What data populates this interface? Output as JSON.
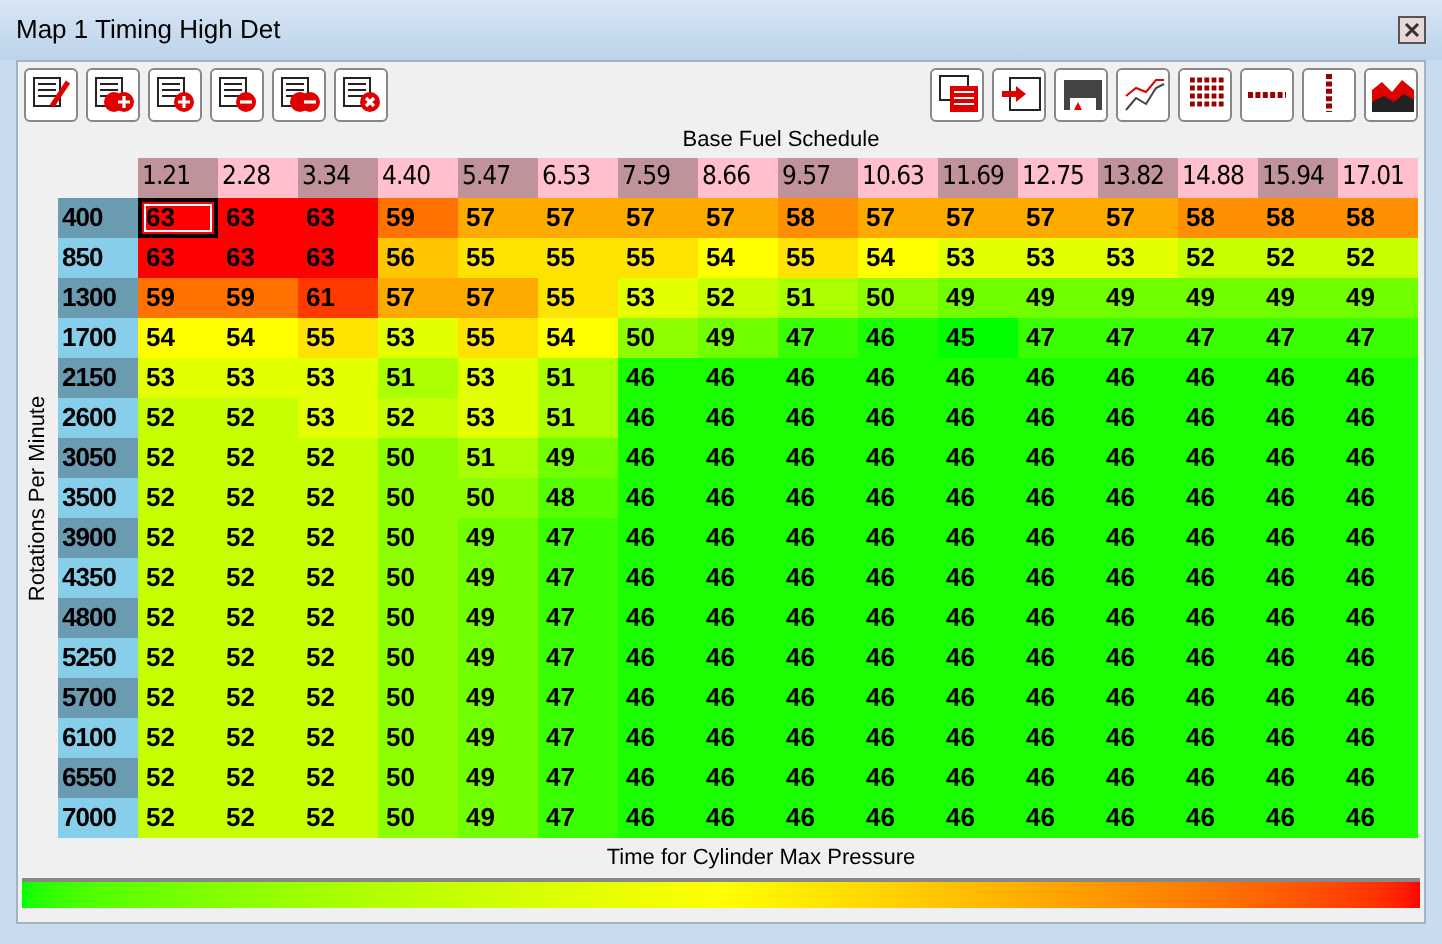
{
  "window": {
    "title": "Map 1 Timing High Det"
  },
  "table": {
    "title": "Base Fuel Schedule",
    "ylabel": "Rotations Per Minute",
    "xlabel": "Time for Cylinder Max Pressure",
    "columns": [
      "1.21",
      "2.28",
      "3.34",
      "4.40",
      "5.47",
      "6.53",
      "7.59",
      "8.66",
      "9.57",
      "10.63",
      "11.69",
      "12.75",
      "13.82",
      "14.88",
      "15.94",
      "17.01"
    ],
    "rows": [
      {
        "rpm": "400",
        "cells": [
          {
            "value": "63",
            "selected": true
          },
          {
            "value": "63",
            "selected": false
          },
          {
            "value": "63",
            "selected": false
          },
          {
            "value": "59",
            "selected": false
          },
          {
            "value": "57",
            "selected": false
          },
          {
            "value": "57",
            "selected": false
          },
          {
            "value": "57",
            "selected": false
          },
          {
            "value": "57",
            "selected": false
          },
          {
            "value": "58",
            "selected": false
          },
          {
            "value": "57",
            "selected": false
          },
          {
            "value": "57",
            "selected": false
          },
          {
            "value": "57",
            "selected": false
          },
          {
            "value": "57",
            "selected": false
          },
          {
            "value": "58",
            "selected": false
          },
          {
            "value": "58",
            "selected": false
          },
          {
            "value": "58",
            "selected": false
          }
        ]
      },
      {
        "rpm": "850",
        "cells": [
          {
            "value": "63",
            "selected": false
          },
          {
            "value": "63",
            "selected": false
          },
          {
            "value": "63",
            "selected": false
          },
          {
            "value": "56",
            "selected": false
          },
          {
            "value": "55",
            "selected": false
          },
          {
            "value": "55",
            "selected": false
          },
          {
            "value": "55",
            "selected": false
          },
          {
            "value": "54",
            "selected": false
          },
          {
            "value": "55",
            "selected": false
          },
          {
            "value": "54",
            "selected": false
          },
          {
            "value": "53",
            "selected": false
          },
          {
            "value": "53",
            "selected": false
          },
          {
            "value": "53",
            "selected": false
          },
          {
            "value": "52",
            "selected": false
          },
          {
            "value": "52",
            "selected": false
          },
          {
            "value": "52",
            "selected": false
          }
        ]
      },
      {
        "rpm": "1300",
        "cells": [
          {
            "value": "59",
            "selected": false
          },
          {
            "value": "59",
            "selected": false
          },
          {
            "value": "61",
            "selected": false
          },
          {
            "value": "57",
            "selected": false
          },
          {
            "value": "57",
            "selected": false
          },
          {
            "value": "55",
            "selected": false
          },
          {
            "value": "53",
            "selected": false
          },
          {
            "value": "52",
            "selected": false
          },
          {
            "value": "51",
            "selected": false
          },
          {
            "value": "50",
            "selected": false
          },
          {
            "value": "49",
            "selected": false
          },
          {
            "value": "49",
            "selected": false
          },
          {
            "value": "49",
            "selected": false
          },
          {
            "value": "49",
            "selected": false
          },
          {
            "value": "49",
            "selected": false
          },
          {
            "value": "49",
            "selected": false
          }
        ]
      },
      {
        "rpm": "1700",
        "cells": [
          {
            "value": "54",
            "selected": false
          },
          {
            "value": "54",
            "selected": false
          },
          {
            "value": "55",
            "selected": false
          },
          {
            "value": "53",
            "selected": false
          },
          {
            "value": "55",
            "selected": false
          },
          {
            "value": "54",
            "selected": false
          },
          {
            "value": "50",
            "selected": false
          },
          {
            "value": "49",
            "selected": false
          },
          {
            "value": "47",
            "selected": false
          },
          {
            "value": "46",
            "selected": false
          },
          {
            "value": "45",
            "selected": false
          },
          {
            "value": "47",
            "selected": false
          },
          {
            "value": "47",
            "selected": false
          },
          {
            "value": "47",
            "selected": false
          },
          {
            "value": "47",
            "selected": false
          },
          {
            "value": "47",
            "selected": false
          }
        ]
      },
      {
        "rpm": "2150",
        "cells": [
          {
            "value": "53",
            "selected": false
          },
          {
            "value": "53",
            "selected": false
          },
          {
            "value": "53",
            "selected": false
          },
          {
            "value": "51",
            "selected": false
          },
          {
            "value": "53",
            "selected": false
          },
          {
            "value": "51",
            "selected": false
          },
          {
            "value": "46",
            "selected": false
          },
          {
            "value": "46",
            "selected": false
          },
          {
            "value": "46",
            "selected": false
          },
          {
            "value": "46",
            "selected": false
          },
          {
            "value": "46",
            "selected": false
          },
          {
            "value": "46",
            "selected": false
          },
          {
            "value": "46",
            "selected": false
          },
          {
            "value": "46",
            "selected": false
          },
          {
            "value": "46",
            "selected": false
          },
          {
            "value": "46",
            "selected": false
          }
        ]
      },
      {
        "rpm": "2600",
        "cells": [
          {
            "value": "52",
            "selected": false
          },
          {
            "value": "52",
            "selected": false
          },
          {
            "value": "53",
            "selected": false
          },
          {
            "value": "52",
            "selected": false
          },
          {
            "value": "53",
            "selected": false
          },
          {
            "value": "51",
            "selected": false
          },
          {
            "value": "46",
            "selected": false
          },
          {
            "value": "46",
            "selected": false
          },
          {
            "value": "46",
            "selected": false
          },
          {
            "value": "46",
            "selected": false
          },
          {
            "value": "46",
            "selected": false
          },
          {
            "value": "46",
            "selected": false
          },
          {
            "value": "46",
            "selected": false
          },
          {
            "value": "46",
            "selected": false
          },
          {
            "value": "46",
            "selected": false
          },
          {
            "value": "46",
            "selected": false
          }
        ]
      },
      {
        "rpm": "3050",
        "cells": [
          {
            "value": "52",
            "selected": false
          },
          {
            "value": "52",
            "selected": false
          },
          {
            "value": "52",
            "selected": false
          },
          {
            "value": "50",
            "selected": false
          },
          {
            "value": "51",
            "selected": false
          },
          {
            "value": "49",
            "selected": false
          },
          {
            "value": "46",
            "selected": false
          },
          {
            "value": "46",
            "selected": false
          },
          {
            "value": "46",
            "selected": false
          },
          {
            "value": "46",
            "selected": false
          },
          {
            "value": "46",
            "selected": false
          },
          {
            "value": "46",
            "selected": false
          },
          {
            "value": "46",
            "selected": false
          },
          {
            "value": "46",
            "selected": false
          },
          {
            "value": "46",
            "selected": false
          },
          {
            "value": "46",
            "selected": false
          }
        ]
      },
      {
        "rpm": "3500",
        "cells": [
          {
            "value": "52",
            "selected": false
          },
          {
            "value": "52",
            "selected": false
          },
          {
            "value": "52",
            "selected": false
          },
          {
            "value": "50",
            "selected": false
          },
          {
            "value": "50",
            "selected": false
          },
          {
            "value": "48",
            "selected": false
          },
          {
            "value": "46",
            "selected": false
          },
          {
            "value": "46",
            "selected": false
          },
          {
            "value": "46",
            "selected": false
          },
          {
            "value": "46",
            "selected": false
          },
          {
            "value": "46",
            "selected": false
          },
          {
            "value": "46",
            "selected": false
          },
          {
            "value": "46",
            "selected": false
          },
          {
            "value": "46",
            "selected": false
          },
          {
            "value": "46",
            "selected": false
          },
          {
            "value": "46",
            "selected": false
          }
        ]
      },
      {
        "rpm": "3900",
        "cells": [
          {
            "value": "52",
            "selected": false
          },
          {
            "value": "52",
            "selected": false
          },
          {
            "value": "52",
            "selected": false
          },
          {
            "value": "50",
            "selected": false
          },
          {
            "value": "49",
            "selected": false
          },
          {
            "value": "47",
            "selected": false
          },
          {
            "value": "46",
            "selected": false
          },
          {
            "value": "46",
            "selected": false
          },
          {
            "value": "46",
            "selected": false
          },
          {
            "value": "46",
            "selected": false
          },
          {
            "value": "46",
            "selected": false
          },
          {
            "value": "46",
            "selected": false
          },
          {
            "value": "46",
            "selected": false
          },
          {
            "value": "46",
            "selected": false
          },
          {
            "value": "46",
            "selected": false
          },
          {
            "value": "46",
            "selected": false
          }
        ]
      },
      {
        "rpm": "4350",
        "cells": [
          {
            "value": "52",
            "selected": false
          },
          {
            "value": "52",
            "selected": false
          },
          {
            "value": "52",
            "selected": false
          },
          {
            "value": "50",
            "selected": false
          },
          {
            "value": "49",
            "selected": false
          },
          {
            "value": "47",
            "selected": false
          },
          {
            "value": "46",
            "selected": false
          },
          {
            "value": "46",
            "selected": false
          },
          {
            "value": "46",
            "selected": false
          },
          {
            "value": "46",
            "selected": false
          },
          {
            "value": "46",
            "selected": false
          },
          {
            "value": "46",
            "selected": false
          },
          {
            "value": "46",
            "selected": false
          },
          {
            "value": "46",
            "selected": false
          },
          {
            "value": "46",
            "selected": false
          },
          {
            "value": "46",
            "selected": false
          }
        ]
      },
      {
        "rpm": "4800",
        "cells": [
          {
            "value": "52",
            "selected": false
          },
          {
            "value": "52",
            "selected": false
          },
          {
            "value": "52",
            "selected": false
          },
          {
            "value": "50",
            "selected": false
          },
          {
            "value": "49",
            "selected": false
          },
          {
            "value": "47",
            "selected": false
          },
          {
            "value": "46",
            "selected": false
          },
          {
            "value": "46",
            "selected": false
          },
          {
            "value": "46",
            "selected": false
          },
          {
            "value": "46",
            "selected": false
          },
          {
            "value": "46",
            "selected": false
          },
          {
            "value": "46",
            "selected": false
          },
          {
            "value": "46",
            "selected": false
          },
          {
            "value": "46",
            "selected": false
          },
          {
            "value": "46",
            "selected": false
          },
          {
            "value": "46",
            "selected": false
          }
        ]
      },
      {
        "rpm": "5250",
        "cells": [
          {
            "value": "52",
            "selected": false
          },
          {
            "value": "52",
            "selected": false
          },
          {
            "value": "52",
            "selected": false
          },
          {
            "value": "50",
            "selected": false
          },
          {
            "value": "49",
            "selected": false
          },
          {
            "value": "47",
            "selected": false
          },
          {
            "value": "46",
            "selected": false
          },
          {
            "value": "46",
            "selected": false
          },
          {
            "value": "46",
            "selected": false
          },
          {
            "value": "46",
            "selected": false
          },
          {
            "value": "46",
            "selected": false
          },
          {
            "value": "46",
            "selected": false
          },
          {
            "value": "46",
            "selected": false
          },
          {
            "value": "46",
            "selected": false
          },
          {
            "value": "46",
            "selected": false
          },
          {
            "value": "46",
            "selected": false
          }
        ]
      },
      {
        "rpm": "5700",
        "cells": [
          {
            "value": "52",
            "selected": false
          },
          {
            "value": "52",
            "selected": false
          },
          {
            "value": "52",
            "selected": false
          },
          {
            "value": "50",
            "selected": false
          },
          {
            "value": "49",
            "selected": false
          },
          {
            "value": "47",
            "selected": false
          },
          {
            "value": "46",
            "selected": false
          },
          {
            "value": "46",
            "selected": false
          },
          {
            "value": "46",
            "selected": false
          },
          {
            "value": "46",
            "selected": false
          },
          {
            "value": "46",
            "selected": false
          },
          {
            "value": "46",
            "selected": false
          },
          {
            "value": "46",
            "selected": false
          },
          {
            "value": "46",
            "selected": false
          },
          {
            "value": "46",
            "selected": false
          },
          {
            "value": "46",
            "selected": false
          }
        ]
      },
      {
        "rpm": "6100",
        "cells": [
          {
            "value": "52",
            "selected": false
          },
          {
            "value": "52",
            "selected": false
          },
          {
            "value": "52",
            "selected": false
          },
          {
            "value": "50",
            "selected": false
          },
          {
            "value": "49",
            "selected": false
          },
          {
            "value": "47",
            "selected": false
          },
          {
            "value": "46",
            "selected": false
          },
          {
            "value": "46",
            "selected": false
          },
          {
            "value": "46",
            "selected": false
          },
          {
            "value": "46",
            "selected": false
          },
          {
            "value": "46",
            "selected": false
          },
          {
            "value": "46",
            "selected": false
          },
          {
            "value": "46",
            "selected": false
          },
          {
            "value": "46",
            "selected": false
          },
          {
            "value": "46",
            "selected": false
          },
          {
            "value": "46",
            "selected": false
          }
        ]
      },
      {
        "rpm": "6550",
        "cells": [
          {
            "value": "52",
            "selected": false
          },
          {
            "value": "52",
            "selected": false
          },
          {
            "value": "52",
            "selected": false
          },
          {
            "value": "50",
            "selected": false
          },
          {
            "value": "49",
            "selected": false
          },
          {
            "value": "47",
            "selected": false
          },
          {
            "value": "46",
            "selected": false
          },
          {
            "value": "46",
            "selected": false
          },
          {
            "value": "46",
            "selected": false
          },
          {
            "value": "46",
            "selected": false
          },
          {
            "value": "46",
            "selected": false
          },
          {
            "value": "46",
            "selected": false
          },
          {
            "value": "46",
            "selected": false
          },
          {
            "value": "46",
            "selected": false
          },
          {
            "value": "46",
            "selected": false
          },
          {
            "value": "46",
            "selected": false
          }
        ]
      },
      {
        "rpm": "7000",
        "cells": [
          {
            "value": "52",
            "selected": false
          },
          {
            "value": "52",
            "selected": false
          },
          {
            "value": "52",
            "selected": false
          },
          {
            "value": "50",
            "selected": false
          },
          {
            "value": "49",
            "selected": false
          },
          {
            "value": "47",
            "selected": false
          },
          {
            "value": "46",
            "selected": false
          },
          {
            "value": "46",
            "selected": false
          },
          {
            "value": "46",
            "selected": false
          },
          {
            "value": "46",
            "selected": false
          },
          {
            "value": "46",
            "selected": false
          },
          {
            "value": "46",
            "selected": false
          },
          {
            "value": "46",
            "selected": false
          },
          {
            "value": "46",
            "selected": false
          },
          {
            "value": "46",
            "selected": false
          },
          {
            "value": "46",
            "selected": false
          }
        ]
      }
    ]
  }
}
